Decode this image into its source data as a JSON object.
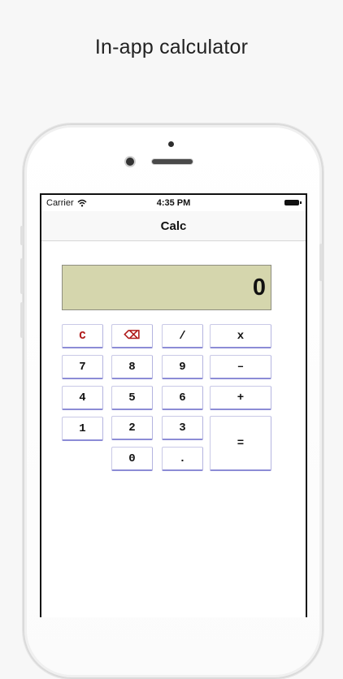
{
  "caption": "In-app calculator",
  "status": {
    "carrier": "Carrier",
    "time": "4:35 PM"
  },
  "nav": {
    "title": "Calc"
  },
  "display": {
    "value": "0"
  },
  "keys": {
    "clear": "C",
    "backspace": "⌫",
    "divide": "/",
    "multiply": "x",
    "k7": "7",
    "k8": "8",
    "k9": "9",
    "subtract": "–",
    "k4": "4",
    "k5": "5",
    "k6": "6",
    "add": "+",
    "k1": "1",
    "k2": "2",
    "k3": "3",
    "equals": "=",
    "k0": "0",
    "decimal": "."
  },
  "colors": {
    "display_bg": "#d5d6ad",
    "clear_key": "#b01a1a"
  }
}
